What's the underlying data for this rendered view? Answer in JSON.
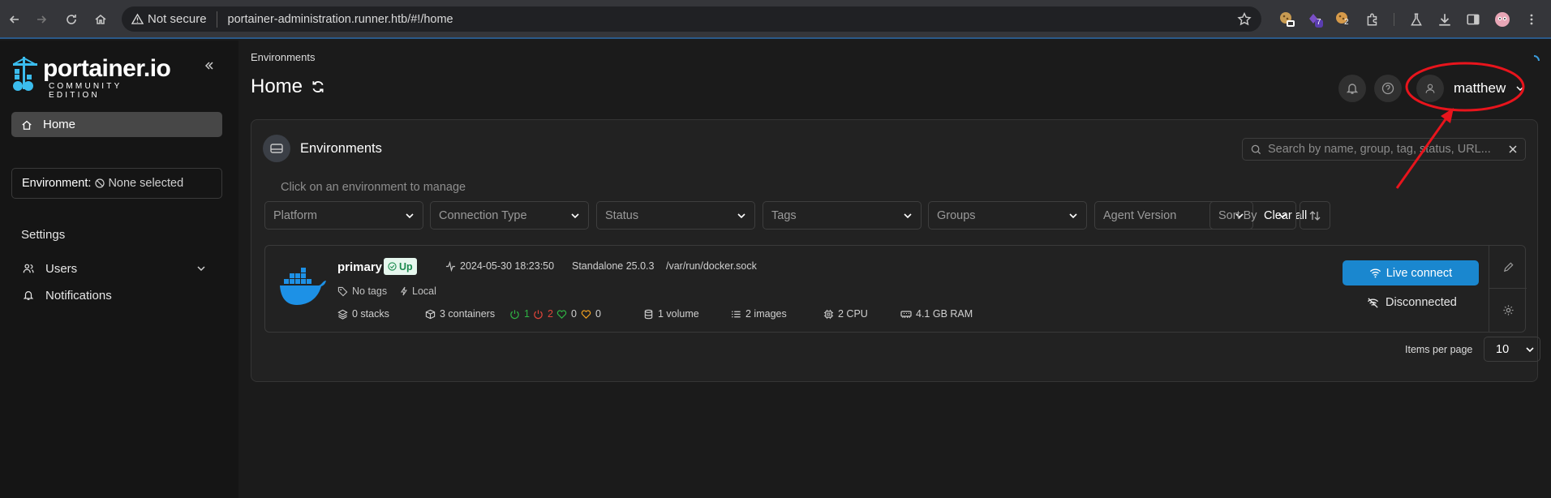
{
  "browser": {
    "not_secure": "Not secure",
    "url": "portainer-administration.runner.htb/#!/home",
    "ext_badge_1": "7",
    "ext_badge_2": "2"
  },
  "sidebar": {
    "logo_text": "portainer.io",
    "logo_sub": "COMMUNITY EDITION",
    "home_label": "Home",
    "environment_label": "Environment:",
    "environment_value": "None selected",
    "settings_title": "Settings",
    "items": [
      {
        "label": "Users",
        "icon": "users-icon"
      },
      {
        "label": "Notifications",
        "icon": "bell-icon"
      }
    ]
  },
  "header": {
    "breadcrumb": "Environments",
    "title": "Home",
    "username": "matthew"
  },
  "panel": {
    "title": "Environments",
    "search_placeholder": "Search by name, group, tag, status, URL...",
    "hint": "Click on an environment to manage",
    "filters": [
      "Platform",
      "Connection Type",
      "Status",
      "Tags",
      "Groups",
      "Agent Version"
    ],
    "clear_all": "Clear all",
    "sort_by": "Sort By",
    "items_per_page_label": "Items per page",
    "items_per_page_value": "10"
  },
  "environment": {
    "name": "primary",
    "status": "Up",
    "timestamp": "2024-05-30 18:23:50",
    "version": "Standalone 25.0.3",
    "url": "/var/run/docker.sock",
    "tags": "No tags",
    "location": "Local",
    "stacks": "0 stacks",
    "containers": "3 containers",
    "running": "1",
    "stopped": "2",
    "healthy": "0",
    "unhealthy": "0",
    "volumes": "1 volume",
    "images": "2 images",
    "cpu": "2 CPU",
    "ram": "4.1 GB RAM",
    "live_connect": "Live connect",
    "disconnected": "Disconnected"
  },
  "colors": {
    "accent_blue": "#1a87cf",
    "running_green": "#2fb344",
    "stopped_red": "#e0453a",
    "unhealthy_orange": "#f0a020",
    "annotation_red": "#e8141c"
  }
}
